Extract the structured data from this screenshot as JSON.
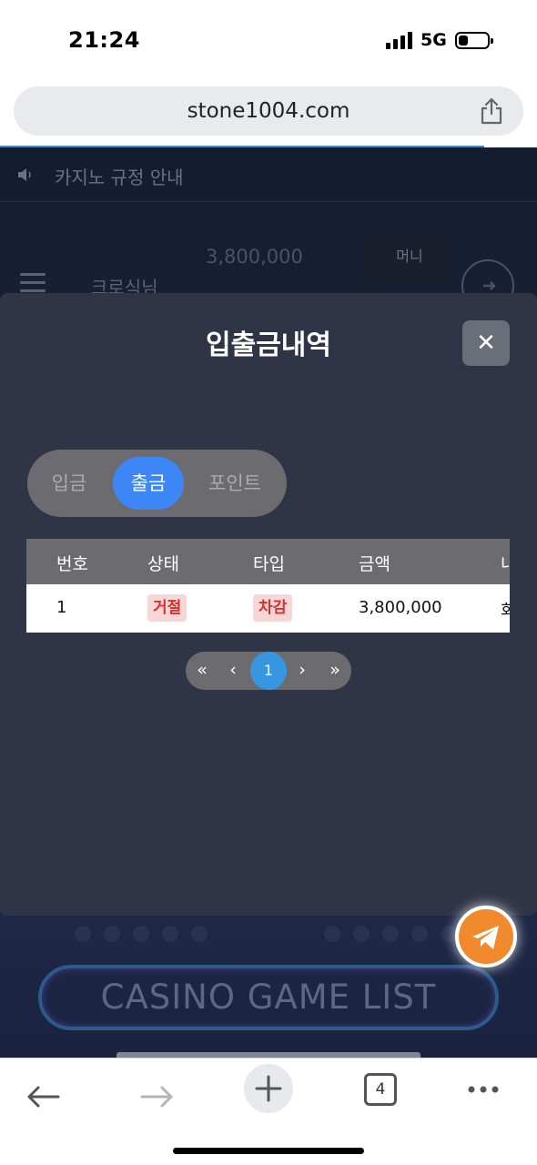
{
  "status_bar": {
    "time": "21:24",
    "network": "5G"
  },
  "browser": {
    "url": "stone1004.com",
    "tab_count": "4"
  },
  "site": {
    "notice": "카지노 규정 안내",
    "balance": "3,800,000",
    "money_button": "머니",
    "username": "크로식님",
    "casino_list": "CASINO GAME LIST"
  },
  "modal": {
    "title": "입출금내역",
    "close": "✕",
    "tabs": [
      {
        "label": "입금",
        "active": false
      },
      {
        "label": "출금",
        "active": true
      },
      {
        "label": "포인트",
        "active": false
      }
    ],
    "table": {
      "headers": [
        "번호",
        "상태",
        "타입",
        "금액",
        "내"
      ],
      "rows": [
        {
          "no": "1",
          "status": "거절",
          "type": "차감",
          "amount": "3,800,000",
          "extra": "회"
        }
      ]
    },
    "pagination": {
      "first": "«",
      "prev": "‹",
      "current": "1",
      "next": "›",
      "last": "»"
    }
  },
  "colors": {
    "accent_blue": "#3d86f5",
    "badge_red": "#d63030",
    "telegram_orange": "#f08a2c"
  },
  "icons": [
    "speaker-icon",
    "share-icon",
    "menu-icon",
    "logout-icon",
    "close-icon",
    "telegram-icon",
    "back-arrow-icon",
    "forward-arrow-icon",
    "plus-icon",
    "more-icon"
  ]
}
